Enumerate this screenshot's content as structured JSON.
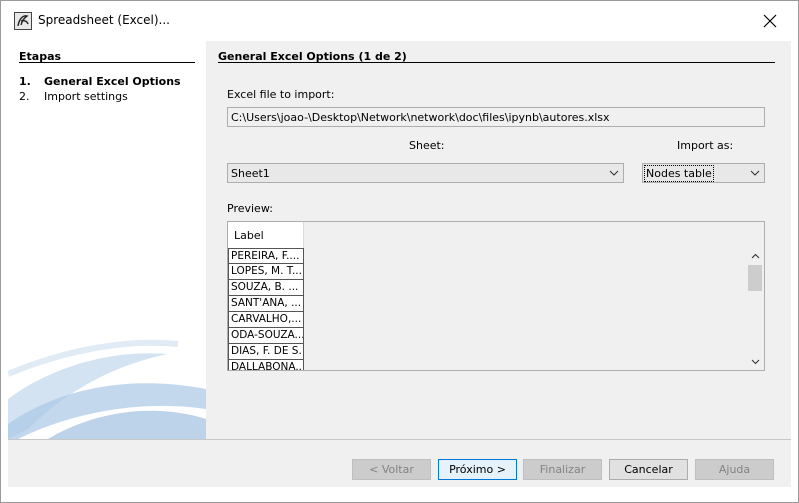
{
  "window": {
    "title": "Spreadsheet (Excel)...",
    "icon": "gephi-app-icon",
    "close_icon": "close-icon"
  },
  "steps": {
    "title": "Etapas",
    "items": [
      {
        "num": "1.",
        "label": "General Excel Options",
        "active": true
      },
      {
        "num": "2.",
        "label": "Import settings",
        "active": false
      }
    ]
  },
  "page": {
    "title": "General Excel Options (1 de 2)",
    "file_label": "Excel file to import:",
    "file_path": "C:\\Users\\joao-\\Desktop\\Network\\network\\doc\\files\\ipynb\\autores.xlsx",
    "sheet_label": "Sheet:",
    "sheet_value": "Sheet1",
    "import_as_label": "Import as:",
    "import_as_value": "Nodes table",
    "preview_label": "Preview:",
    "preview": {
      "column_header": "Label",
      "rows": [
        "PEREIRA, F....",
        "LOPES, M. T...",
        "SOUZA, B. ...",
        "SANT'ANA, ...",
        "CARVALHO,...",
        "ODA-SOUZA...",
        "DIAS, F. DE S.",
        "DALLABONA..."
      ]
    }
  },
  "buttons": {
    "back": "< Voltar",
    "next": "Próximo >",
    "finish": "Finalizar",
    "cancel": "Cancelar",
    "help": "Ajuda"
  },
  "colors": {
    "panel_bg": "#f0f0f0",
    "accent_border": "#0078d7",
    "disabled_text": "#838383"
  }
}
